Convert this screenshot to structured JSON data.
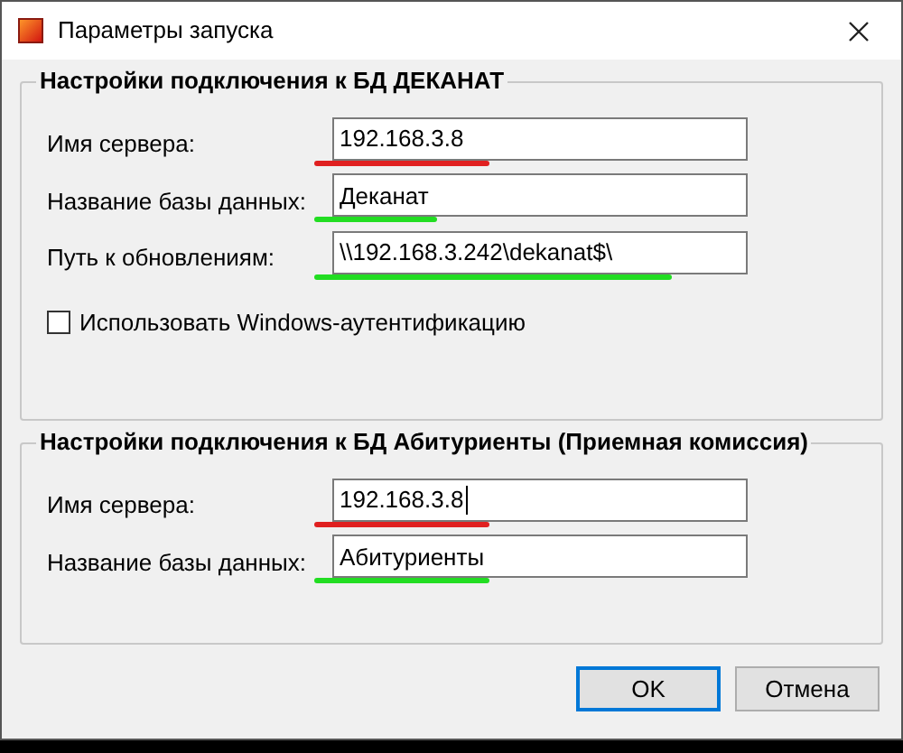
{
  "window": {
    "title": "Параметры запуска"
  },
  "groups": [
    {
      "title": "Настройки подключения к БД ДЕКАНАТ",
      "fields": [
        {
          "label": "Имя сервера:",
          "value": "192.168.3.8",
          "color": "#e02020",
          "focused": false
        },
        {
          "label": "Название базы данных:",
          "value": "Деканат",
          "color": "#22dd22",
          "focused": false
        },
        {
          "label": "Путь к обновлениям:",
          "value": "\\\\192.168.3.242\\dekanat$\\",
          "color": "#22dd22",
          "focused": false
        }
      ],
      "checkbox": {
        "label": "Использовать Windows-аутентификацию",
        "checked": false
      }
    },
    {
      "title": "Настройки подключения к БД Абитуриенты (Приемная комиссия)",
      "fields": [
        {
          "label": "Имя сервера:",
          "value": "192.168.3.8",
          "color": "#e02020",
          "focused": true
        },
        {
          "label": "Название базы данных:",
          "value": "Абитуриенты",
          "color": "#22dd22",
          "focused": false
        }
      ]
    }
  ],
  "buttons": [
    {
      "label": "OK",
      "default": true
    },
    {
      "label": "Отмена",
      "default": false
    }
  ]
}
